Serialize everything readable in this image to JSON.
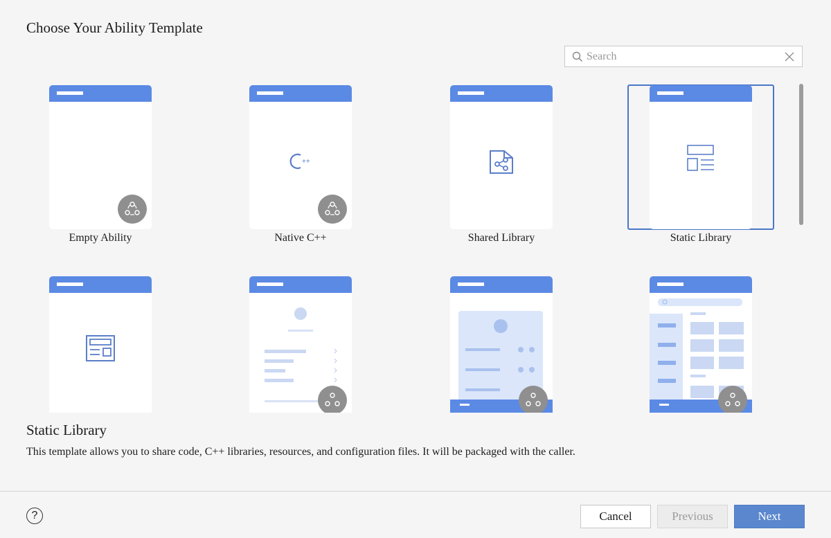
{
  "dialog": {
    "title": "Choose Your Ability Template"
  },
  "search": {
    "placeholder": "Search"
  },
  "templates": [
    {
      "label": "Empty Ability"
    },
    {
      "label": "Native C++"
    },
    {
      "label": "Shared Library"
    },
    {
      "label": "Static Library",
      "selected": true
    },
    {
      "label": ""
    },
    {
      "label": ""
    },
    {
      "label": ""
    },
    {
      "label": ""
    }
  ],
  "description": {
    "title": "Static Library",
    "text": "This template allows you to share code, C++ libraries, resources, and configuration files. It will be packaged with the caller."
  },
  "footer": {
    "help_label": "?",
    "cancel_label": "Cancel",
    "previous_label": "Previous",
    "next_label": "Next"
  },
  "colors": {
    "accent": "#5b8ae5",
    "selection": "#4a77c4",
    "next_button": "#5a87ce"
  }
}
